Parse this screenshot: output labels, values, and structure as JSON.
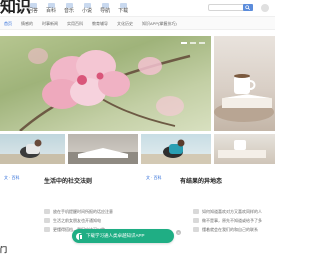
{
  "header": {
    "logo": "知识",
    "nav": [
      "问答",
      "百科",
      "音乐",
      "小说",
      "导航",
      "下载"
    ],
    "search_placeholder": ""
  },
  "tabs": [
    "首页",
    "情感的",
    "时事新闻",
    "实用百科",
    "教育辅导",
    "文化历史",
    "知识APP(掌握技巧)"
  ],
  "hero": {
    "icon": "peach-blossom-image",
    "slides_total": 3,
    "active_slide": 1
  },
  "cards": [
    {
      "tag": "文 · 百科",
      "title": "生活中的社交法则"
    },
    {
      "tag": "文 · 百科",
      "title": "有结果的异地恋"
    }
  ],
  "left_list": [
    "放在手机提醒时间所报的话应注意",
    "生活之前女朋友也开通知电",
    "更懂得搭档，我们应该可以做"
  ],
  "right_list": [
    "如何知道喜欢对方又喜欢同样的人",
    "做不是事，原先不知道或给予了多",
    "懂着就会在我们的和自己的联系"
  ],
  "bottom": {
    "section_title": "门",
    "app_banner": "下载学习通人类卓越知识APP",
    "close": "×"
  },
  "colors": {
    "accent": "#2a6ad8",
    "app_banner": "#1fae84"
  }
}
